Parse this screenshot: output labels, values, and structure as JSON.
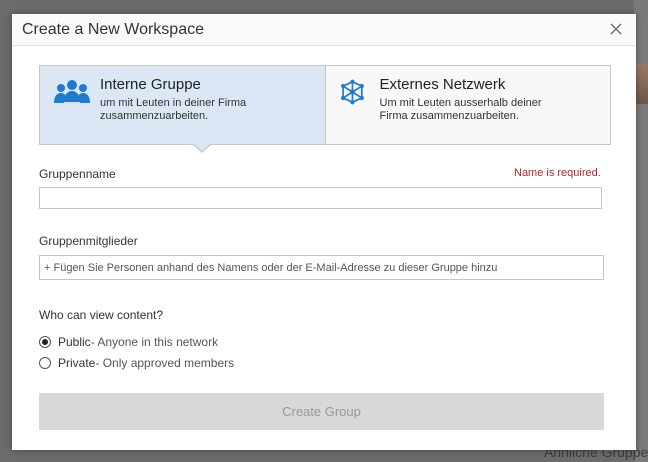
{
  "modal": {
    "title": "Create a New Workspace"
  },
  "workspace_types": [
    {
      "title": "Interne Gruppe",
      "description_line1": "um mit Leuten in deiner Firma",
      "description_line2": "zusammenzuarbeiten.",
      "icon": "group-people-icon",
      "selected": true
    },
    {
      "title": "Externes Netzwerk",
      "description_line1": "Um mit Leuten ausserhalb deiner",
      "description_line2": "Firma zusammenzuarbeiten.",
      "icon": "network-hub-icon",
      "selected": false
    }
  ],
  "form": {
    "group_name_label": "Gruppenname",
    "group_name_error": "Name is required.",
    "group_name_value": "",
    "members_label": "Gruppenmitglieder",
    "members_placeholder": "+ Fügen Sie Personen anhand des Namens oder der E-Mail-Adresse zu dieser Gruppe hinzu",
    "visibility_label": "Who can view content?",
    "visibility_options": [
      {
        "label": "Public",
        "description": " - Anyone in this network",
        "checked": true
      },
      {
        "label": "Private",
        "description": " - Only approved members",
        "checked": false
      }
    ],
    "submit_label": "Create Group"
  },
  "background": {
    "bottom_text": "Ähnliche Gruppe"
  },
  "colors": {
    "selected_tile": "#dbe7f5",
    "icon_blue": "#1f7bd1",
    "error_red": "#b1272e",
    "disabled_button": "#d8d8d8"
  }
}
